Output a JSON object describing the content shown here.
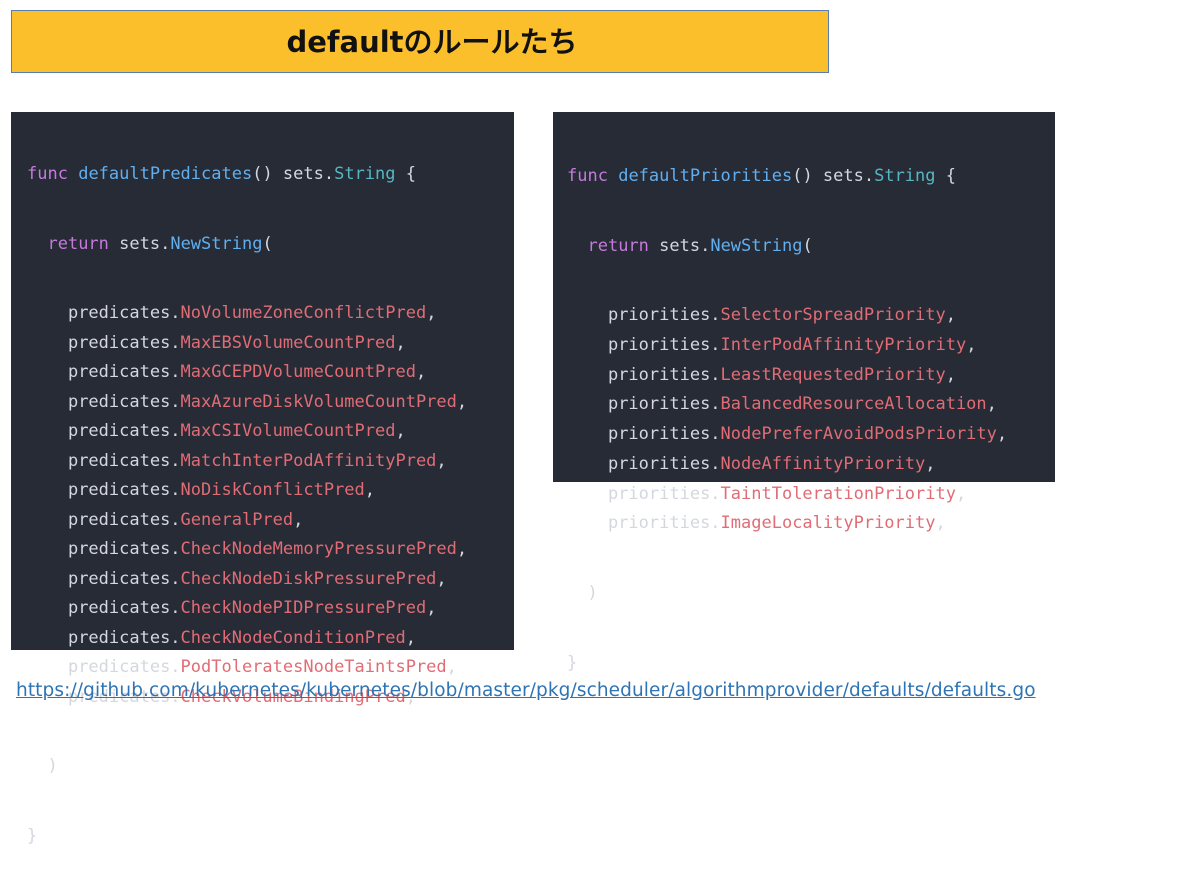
{
  "title": "defaultのルールたち",
  "left_code": {
    "keyword_func": "func",
    "func_name": "defaultPredicates",
    "sig_open": "() sets.",
    "ret_type": "String",
    "sig_close": " {",
    "keyword_return": "return",
    "call_prefix": " sets.",
    "call_name": "NewString",
    "call_open": "(",
    "pkg": "predicates.",
    "items": [
      "NoVolumeZoneConflictPred",
      "MaxEBSVolumeCountPred",
      "MaxGCEPDVolumeCountPred",
      "MaxAzureDiskVolumeCountPred",
      "MaxCSIVolumeCountPred",
      "MatchInterPodAffinityPred",
      "NoDiskConflictPred",
      "GeneralPred",
      "CheckNodeMemoryPressurePred",
      "CheckNodeDiskPressurePred",
      "CheckNodePIDPressurePred",
      "CheckNodeConditionPred",
      "PodToleratesNodeTaintsPred",
      "CheckVolumeBindingPred"
    ],
    "comma": ",",
    "close_paren": ")",
    "close_brace": "}"
  },
  "right_code": {
    "keyword_func": "func",
    "func_name": "defaultPriorities",
    "sig_open": "() sets.",
    "ret_type": "String",
    "sig_close": " {",
    "keyword_return": "return",
    "call_prefix": " sets.",
    "call_name": "NewString",
    "call_open": "(",
    "pkg": "priorities.",
    "items": [
      "SelectorSpreadPriority",
      "InterPodAffinityPriority",
      "LeastRequestedPriority",
      "BalancedResourceAllocation",
      "NodePreferAvoidPodsPriority",
      "NodeAffinityPriority",
      "TaintTolerationPriority",
      "ImageLocalityPriority"
    ],
    "comma": ",",
    "close_paren": ")",
    "close_brace": "}"
  },
  "source_url": "https://github.com/kubernetes/kubernetes/blob/master/pkg/scheduler/algorithmprovider/defaults/defaults.go",
  "colors": {
    "title_bg": "#fbbf2c",
    "code_bg": "#262b36",
    "keyword": "#c678dd",
    "function": "#61afef",
    "type": "#56b6c2",
    "identifier": "#e06c75",
    "link": "#2e74b5"
  }
}
